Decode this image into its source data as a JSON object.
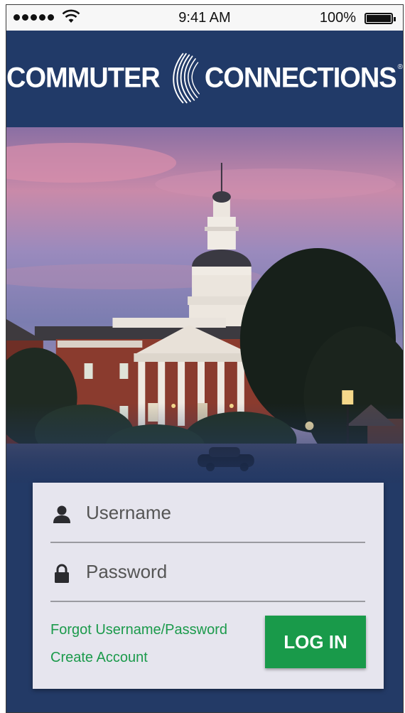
{
  "status_bar": {
    "time": "9:41 AM",
    "battery_percent": "100%",
    "signal_bars": 5
  },
  "header": {
    "logo_left": "COMMUTER",
    "logo_right": "CONNECTIONS",
    "logo_mark": "®"
  },
  "login_form": {
    "username_placeholder": "Username",
    "password_placeholder": "Password",
    "forgot_link": "Forgot Username/Password",
    "create_link": "Create Account",
    "login_button": "LOG IN"
  },
  "colors": {
    "brand_navy": "#233a66",
    "accent_green": "#199a4a",
    "card_background": "#e6e5ee"
  },
  "icons": {
    "username": "user-icon",
    "password": "lock-icon",
    "logo": "wave-swoosh-icon"
  }
}
